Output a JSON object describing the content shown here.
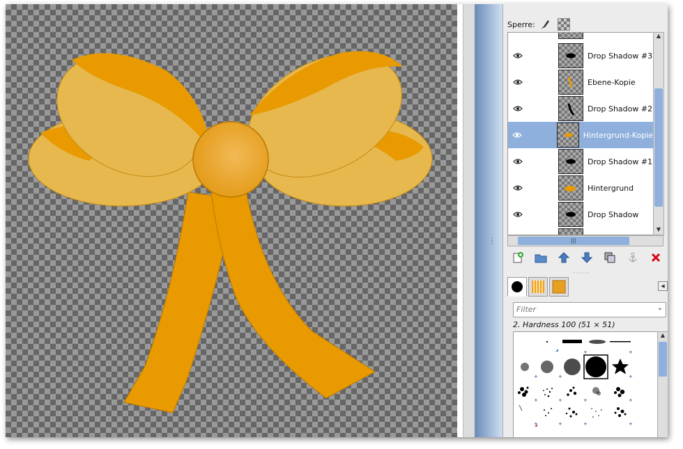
{
  "layers_panel": {
    "lock_label": "Sperre:",
    "layers": [
      {
        "name": "Drop Shadow #3",
        "selected": false,
        "thumb": "black-oval"
      },
      {
        "name": "Ebene-Kopie",
        "selected": false,
        "thumb": "orange-stroke"
      },
      {
        "name": "Drop Shadow #2",
        "selected": false,
        "thumb": "black-stroke"
      },
      {
        "name": "Hintergrund-Kopie",
        "selected": true,
        "thumb": "orange-small"
      },
      {
        "name": "Drop Shadow #1",
        "selected": false,
        "thumb": "black-oval"
      },
      {
        "name": "Hintergrund",
        "selected": false,
        "thumb": "orange-oval"
      },
      {
        "name": "Drop Shadow",
        "selected": false,
        "thumb": "black-oval"
      }
    ],
    "buttons": [
      "new-layer-icon",
      "new-group-icon",
      "raise-layer-icon",
      "lower-layer-icon",
      "duplicate-layer-icon",
      "anchor-icon",
      "delete-layer-icon"
    ]
  },
  "brushes_panel": {
    "filter_placeholder": "Filter",
    "selected_brush": "2. Hardness 100 (51 × 51)"
  },
  "colors": {
    "ribbon_orange": "#e89a00",
    "ribbon_light": "#e6b84e",
    "selection_blue": "#8fb0dc"
  }
}
